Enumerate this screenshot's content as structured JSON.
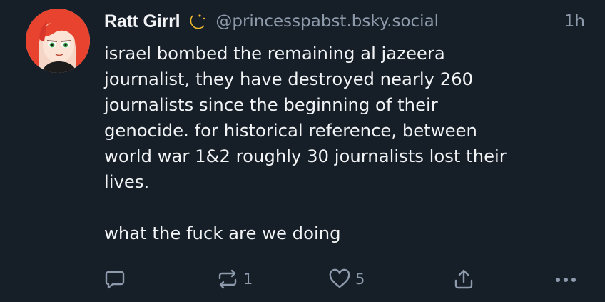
{
  "post": {
    "author": {
      "display_name": "Ratt Girrl",
      "handle": "@princesspabst.bsky.social",
      "name_emoji": "moon-with-stars-icon"
    },
    "timestamp": "1h",
    "body_lines": [
      "israel bombed the remaining al jazeera",
      "journalist, they have destroyed nearly 260",
      "journalists since the beginning of their",
      "genocide. for historical reference, between",
      "world war 1&2 roughly 30 journalists lost their",
      "lives."
    ],
    "body_final": "what the fuck are we doing",
    "actions": {
      "reply": {
        "icon": "reply-icon"
      },
      "repost": {
        "icon": "repost-icon",
        "count": "1"
      },
      "like": {
        "icon": "heart-icon",
        "count": "5"
      },
      "share": {
        "icon": "share-icon"
      },
      "more": {
        "icon": "more-options-icon"
      }
    }
  },
  "theme": {
    "background": "#161e27",
    "text": "#f1f3f5",
    "muted": "#8c9aab",
    "avatar_hair": "#e8432f"
  }
}
